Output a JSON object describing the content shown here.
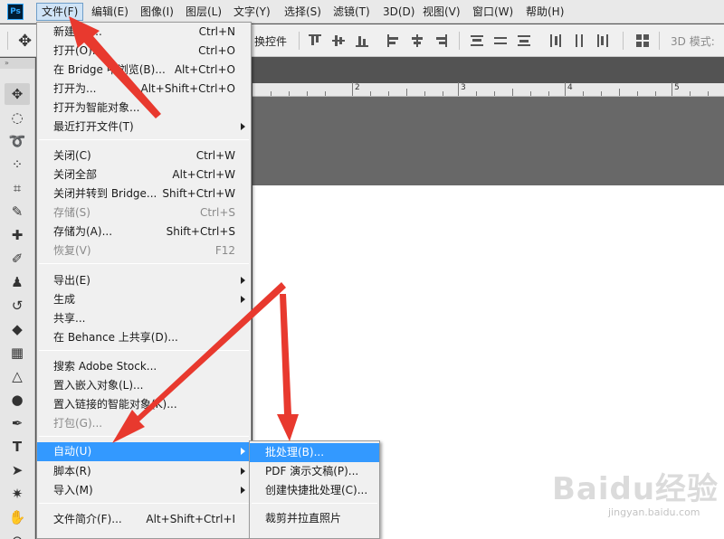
{
  "app": {
    "logo": "Ps"
  },
  "menubar": {
    "items": [
      {
        "label": "文件(F)",
        "active": true
      },
      {
        "label": "编辑(E)"
      },
      {
        "label": "图像(I)"
      },
      {
        "label": "图层(L)"
      },
      {
        "label": "文字(Y)"
      },
      {
        "label": "选择(S)"
      },
      {
        "label": "滤镜(T)"
      },
      {
        "label": "3D(D)"
      },
      {
        "label": "视图(V)"
      },
      {
        "label": "窗口(W)"
      },
      {
        "label": "帮助(H)"
      }
    ]
  },
  "options_bar": {
    "controls_label": "换控件",
    "mode_3d_label": "3D 模式:"
  },
  "ruler": {
    "labels": [
      "2",
      "3",
      "4",
      "5"
    ]
  },
  "file_menu": {
    "items": [
      {
        "label": "新建(N)...",
        "shortcut": "Ctrl+N"
      },
      {
        "label": "打开(O)...",
        "shortcut": "Ctrl+O"
      },
      {
        "label": "在 Bridge 中浏览(B)...",
        "shortcut": "Alt+Ctrl+O"
      },
      {
        "label": "打开为...",
        "shortcut": "Alt+Shift+Ctrl+O"
      },
      {
        "label": "打开为智能对象...",
        "shortcut": ""
      },
      {
        "label": "最近打开文件(T)",
        "shortcut": "",
        "submenu": true
      },
      {
        "label": "关闭(C)",
        "shortcut": "Ctrl+W"
      },
      {
        "label": "关闭全部",
        "shortcut": "Alt+Ctrl+W"
      },
      {
        "label": "关闭并转到 Bridge...",
        "shortcut": "Shift+Ctrl+W"
      },
      {
        "label": "存储(S)",
        "shortcut": "Ctrl+S",
        "disabled": true
      },
      {
        "label": "存储为(A)...",
        "shortcut": "Shift+Ctrl+S"
      },
      {
        "label": "恢复(V)",
        "shortcut": "F12",
        "disabled": true
      },
      {
        "label": "导出(E)",
        "shortcut": "",
        "submenu": true
      },
      {
        "label": "生成",
        "shortcut": "",
        "submenu": true
      },
      {
        "label": "共享...",
        "shortcut": ""
      },
      {
        "label": "在 Behance 上共享(D)...",
        "shortcut": ""
      },
      {
        "label": "搜索 Adobe Stock...",
        "shortcut": ""
      },
      {
        "label": "置入嵌入对象(L)...",
        "shortcut": ""
      },
      {
        "label": "置入链接的智能对象(K)...",
        "shortcut": ""
      },
      {
        "label": "打包(G)...",
        "shortcut": "",
        "disabled": true
      },
      {
        "label": "自动(U)",
        "shortcut": "",
        "submenu": true,
        "highlighted": true
      },
      {
        "label": "脚本(R)",
        "shortcut": "",
        "submenu": true
      },
      {
        "label": "导入(M)",
        "shortcut": "",
        "submenu": true
      },
      {
        "label": "文件简介(F)...",
        "shortcut": "Alt+Shift+Ctrl+I"
      }
    ]
  },
  "automate_submenu": {
    "items": [
      {
        "label": "批处理(B)...",
        "highlighted": true
      },
      {
        "label": "PDF 演示文稿(P)..."
      },
      {
        "label": "创建快捷批处理(C)..."
      },
      {
        "label": "裁剪并拉直照片"
      }
    ]
  },
  "watermark": {
    "text": "Baidu经验",
    "subtext": "jingyan.baidu.com"
  },
  "annotation_color": "#e8392e",
  "highlight_color": "#3399ff"
}
